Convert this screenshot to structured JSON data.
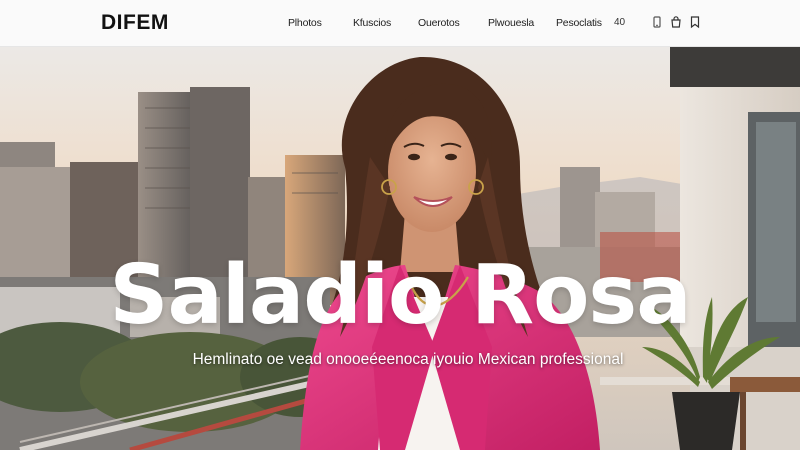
{
  "brand": {
    "logo_text": "DIFEM"
  },
  "nav": {
    "items": [
      {
        "label": "Plhotos"
      },
      {
        "label": "Kfuscios"
      },
      {
        "label": "Ouerotos"
      },
      {
        "label": "Plwouesla"
      },
      {
        "label": "Pesoclatis"
      }
    ],
    "count": "40"
  },
  "header_icons": [
    "mobile-icon",
    "bag-icon",
    "bookmark-icon"
  ],
  "hero": {
    "title": "Saladio Rosa",
    "subtitle": "Hemlinato oe vead onooeéeenoca iyouio Mexican professional"
  },
  "colors": {
    "accent_blazer": "#e1307a",
    "title_text": "#ffffff",
    "header_bg": "#fafafa"
  }
}
